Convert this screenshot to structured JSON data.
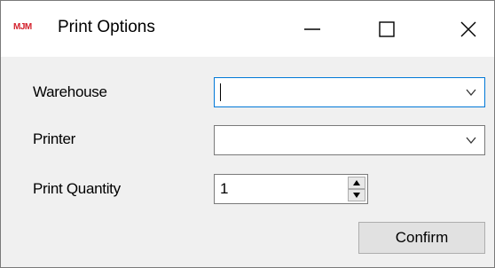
{
  "window": {
    "logo_text": "MJM",
    "title": "Print Options",
    "controls": {
      "minimize": "minimize-icon",
      "maximize": "maximize-icon",
      "close": "close-icon"
    }
  },
  "form": {
    "warehouse": {
      "label": "Warehouse",
      "value": ""
    },
    "printer": {
      "label": "Printer",
      "value": ""
    },
    "print_quantity": {
      "label": "Print Quantity",
      "value": "1"
    }
  },
  "buttons": {
    "confirm": "Confirm"
  },
  "colors": {
    "logo": "#d4232e",
    "focus_border": "#0078d7",
    "dialog_bg": "#f0f0f0"
  }
}
